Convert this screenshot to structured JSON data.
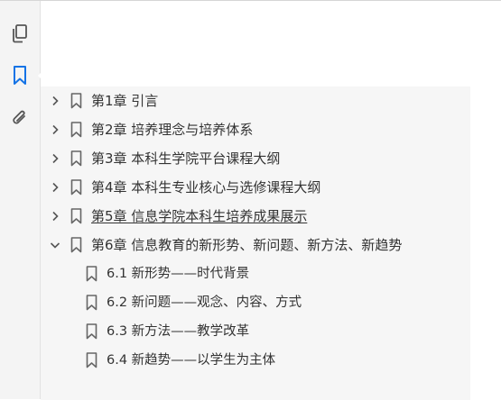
{
  "sidebar": {
    "tools": [
      {
        "name": "pages-icon"
      },
      {
        "name": "bookmark-icon",
        "active": true
      },
      {
        "name": "attachment-icon"
      }
    ],
    "accent": "#1473e6"
  },
  "bookmarks": [
    {
      "label": "第1章 引言",
      "expanded": false
    },
    {
      "label": "第2章 培养理念与培养体系",
      "expanded": false
    },
    {
      "label": "第3章 本科生学院平台课程大纲",
      "expanded": false
    },
    {
      "label": "第4章 本科生专业核心与选修课程大纲",
      "expanded": false
    },
    {
      "label": "第5章 信息学院本科生培养成果展示",
      "expanded": false,
      "hovered": true
    },
    {
      "label": "第6章 信息教育的新形势、新问题、新方法、新趋势",
      "expanded": true,
      "children": [
        {
          "label": "6.1 新形势——时代背景"
        },
        {
          "label": "6.2 新问题——观念、内容、方式"
        },
        {
          "label": "6.3 新方法——教学改革"
        },
        {
          "label": "6.4 新趋势——以学生为主体"
        }
      ]
    }
  ]
}
